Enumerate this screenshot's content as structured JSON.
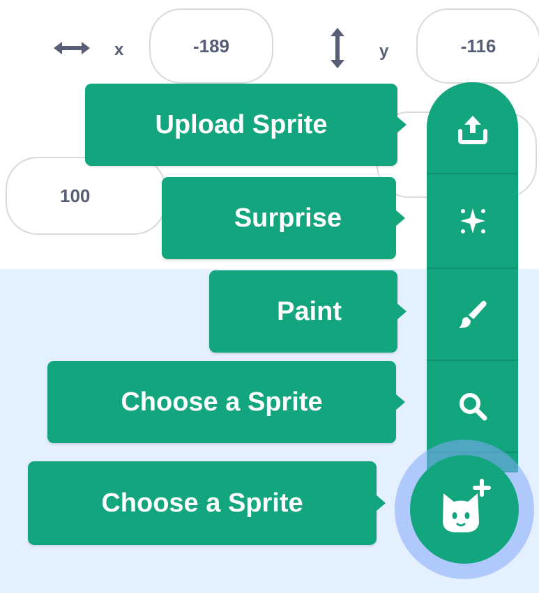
{
  "sprite_info": {
    "x_label": "x",
    "x_value": "-189",
    "y_label": "y",
    "y_value": "-116",
    "size_value": "100"
  },
  "sprite_menu": {
    "upload_label": "Upload Sprite",
    "surprise_label": "Surprise",
    "paint_label": "Paint",
    "search_label": "Choose a Sprite",
    "main_label": "Choose a Sprite"
  },
  "colors": {
    "accent_green": "#12a57e",
    "stage_blue_bg": "#e5f0ff",
    "focus_ring": "#85aafa",
    "text_gray": "#575e75"
  }
}
